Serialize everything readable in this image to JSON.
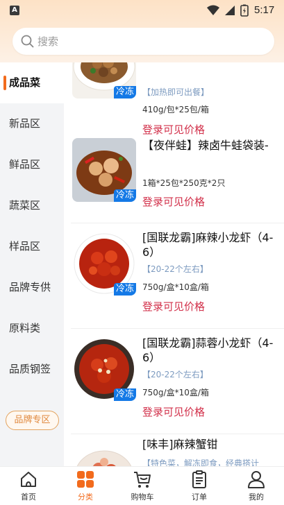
{
  "status_bar": {
    "time": "5:17",
    "app_icon_letter": "A"
  },
  "search": {
    "placeholder": "搜索"
  },
  "sidebar": {
    "items": [
      {
        "label": "成品菜",
        "active": true
      },
      {
        "label": "新品区",
        "active": false
      },
      {
        "label": "鲜品区",
        "active": false
      },
      {
        "label": "蔬菜区",
        "active": false
      },
      {
        "label": "样品区",
        "active": false
      },
      {
        "label": "品牌专供",
        "active": false
      },
      {
        "label": "原料类",
        "active": false
      },
      {
        "label": "品质钢签",
        "active": false
      }
    ],
    "brand_zone_label": "品牌专区"
  },
  "products": [
    {
      "title": "",
      "tag": "【加热即可出餐】",
      "spec": "410g/包*25包/箱",
      "price": "登录可见价格",
      "frozen": "冷冻"
    },
    {
      "title": "【夜伴蛙】辣卤牛蛙袋装-",
      "tag": "",
      "spec": "1箱*25包*250克*2只",
      "price": "登录可见价格",
      "frozen": "冷冻"
    },
    {
      "title": "[国联龙霸]麻辣小龙虾（4-6）",
      "tag": "【20-22个左右】",
      "spec": "750g/盒*10盒/箱",
      "price": "登录可见价格",
      "frozen": "冷冻"
    },
    {
      "title": "[国联龙霸]蒜蓉小龙虾（4-6）",
      "tag": "【20-22个左右】",
      "spec": "750g/盒*10盒/箱",
      "price": "登录可见价格",
      "frozen": "冷冻"
    },
    {
      "title": "[味丰]麻辣蟹钳",
      "tag": "【特色菜，解冻即食，经典搭计",
      "spec": "",
      "price": "",
      "frozen": ""
    }
  ],
  "bottom_nav": {
    "items": [
      {
        "label": "首页",
        "icon": "home-icon",
        "active": false
      },
      {
        "label": "分类",
        "icon": "category-icon",
        "active": true
      },
      {
        "label": "购物车",
        "icon": "cart-icon",
        "active": false
      },
      {
        "label": "订单",
        "icon": "order-icon",
        "active": false
      },
      {
        "label": "我的",
        "icon": "profile-icon",
        "active": false
      }
    ]
  },
  "colors": {
    "accent": "#f26b1d",
    "price": "#d2304a",
    "frozen_tag": "#1479e6",
    "tag_text": "#7d9bc0"
  }
}
